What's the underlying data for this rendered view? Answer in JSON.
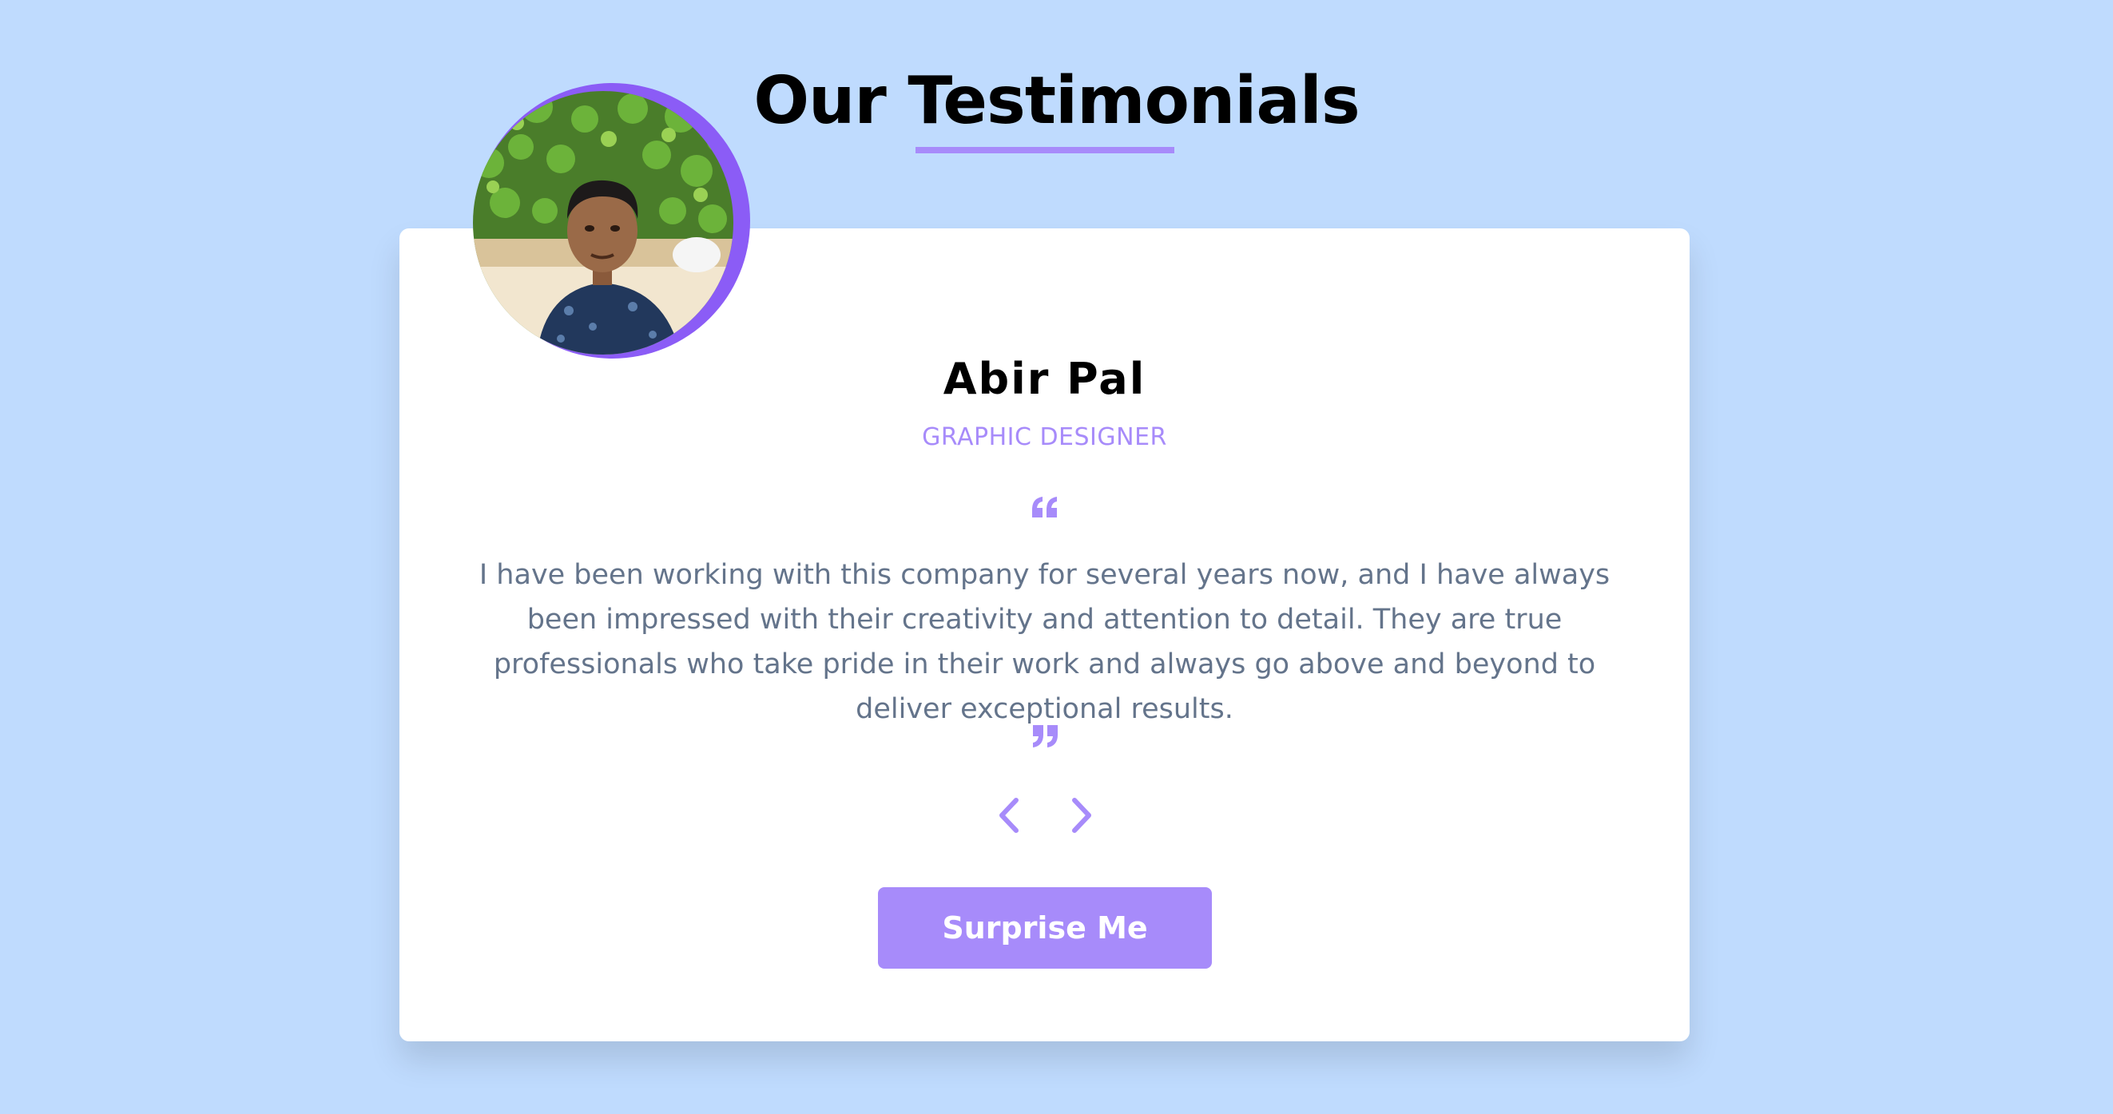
{
  "header": {
    "title": "Our Testimonials"
  },
  "testimonial": {
    "name": "Abir Pal",
    "role": "GRAPHIC DESIGNER",
    "text": "I have been working with this company for several years now, and I have always been impressed with their creativity and attention to detail. They are true professionals who take pride in their work and always go above and beyond to deliver exceptional results."
  },
  "navigation": {
    "prev_icon": "chevron-left-icon",
    "next_icon": "chevron-right-icon"
  },
  "actions": {
    "surprise_label": "Surprise Me"
  },
  "colors": {
    "background": "#bfdbfe",
    "accent": "#a78bfa",
    "ring": "#8b5cf6",
    "text": "#64748b",
    "card": "#ffffff"
  }
}
